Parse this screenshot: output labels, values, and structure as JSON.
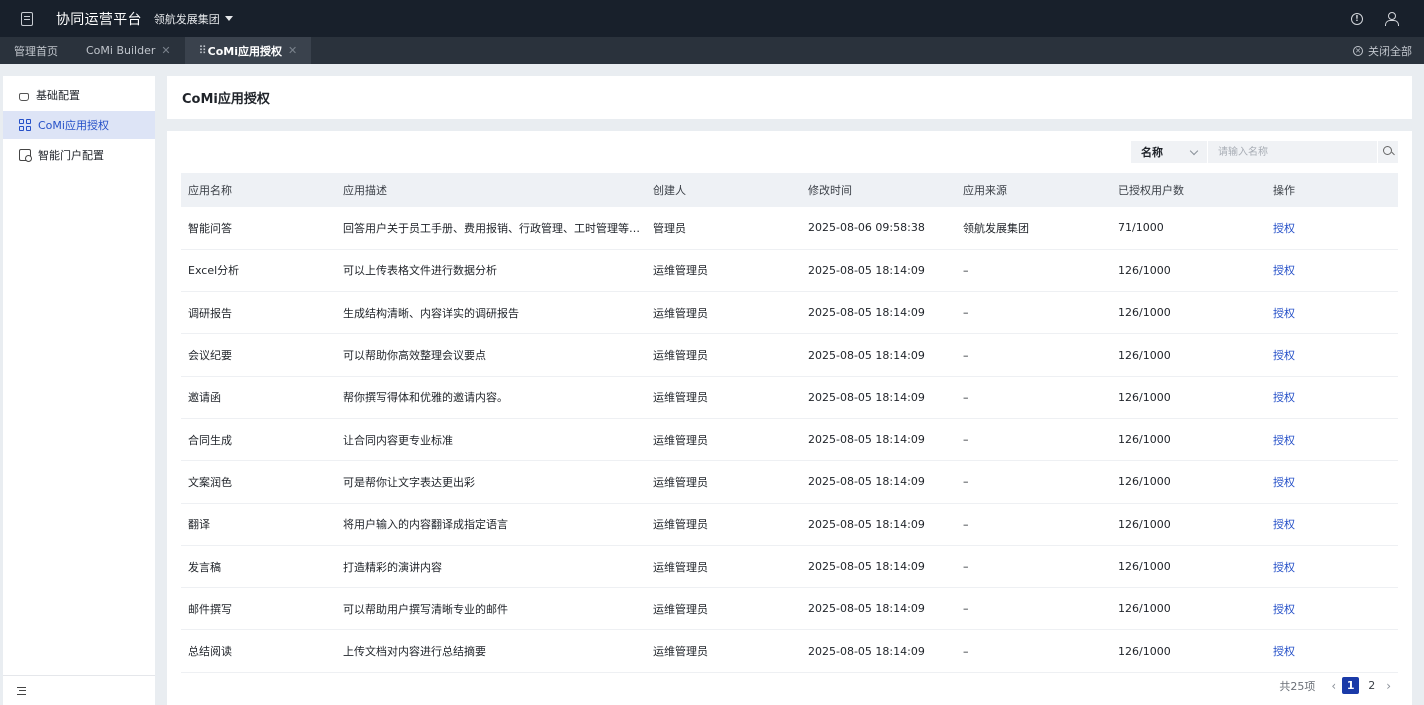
{
  "topbar": {
    "app_title": "协同运营平台",
    "org_name": "领航发展集团"
  },
  "tabs": [
    {
      "label": "管理首页",
      "closable": false
    },
    {
      "label": "CoMi Builder",
      "closable": true
    },
    {
      "label": "CoMi应用授权",
      "closable": true,
      "active": true
    }
  ],
  "tabbar": {
    "close_all": "关闭全部"
  },
  "sidebar": {
    "items": [
      {
        "label": "基础配置",
        "icon": "hand-icon"
      },
      {
        "label": "CoMi应用授权",
        "icon": "grid-icon",
        "active": true
      },
      {
        "label": "智能门户配置",
        "icon": "portal-icon"
      }
    ]
  },
  "page": {
    "title": "CoMi应用授权"
  },
  "search": {
    "field_selected": "名称",
    "placeholder": "请输入名称"
  },
  "table": {
    "columns": [
      "应用名称",
      "应用描述",
      "创建人",
      "修改时间",
      "应用来源",
      "已授权用户数",
      "操作"
    ],
    "rows": [
      {
        "name": "智能问答",
        "desc": "回答用户关于员工手册、费用报销、行政管理、工时管理等相…",
        "creator": "管理员",
        "modified": "2025-08-06 09:58:38",
        "source": "领航发展集团",
        "users": "71/1000",
        "action": "授权"
      },
      {
        "name": "Excel分析",
        "desc": "可以上传表格文件进行数据分析",
        "creator": "运维管理员",
        "modified": "2025-08-05 18:14:09",
        "source": "–",
        "users": "126/1000",
        "action": "授权"
      },
      {
        "name": "调研报告",
        "desc": "生成结构清晰、内容详实的调研报告",
        "creator": "运维管理员",
        "modified": "2025-08-05 18:14:09",
        "source": "–",
        "users": "126/1000",
        "action": "授权"
      },
      {
        "name": "会议纪要",
        "desc": "可以帮助你高效整理会议要点",
        "creator": "运维管理员",
        "modified": "2025-08-05 18:14:09",
        "source": "–",
        "users": "126/1000",
        "action": "授权"
      },
      {
        "name": "邀请函",
        "desc": "帮你撰写得体和优雅的邀请内容。",
        "creator": "运维管理员",
        "modified": "2025-08-05 18:14:09",
        "source": "–",
        "users": "126/1000",
        "action": "授权"
      },
      {
        "name": "合同生成",
        "desc": "让合同内容更专业标准",
        "creator": "运维管理员",
        "modified": "2025-08-05 18:14:09",
        "source": "–",
        "users": "126/1000",
        "action": "授权"
      },
      {
        "name": "文案润色",
        "desc": "可是帮你让文字表达更出彩",
        "creator": "运维管理员",
        "modified": "2025-08-05 18:14:09",
        "source": "–",
        "users": "126/1000",
        "action": "授权"
      },
      {
        "name": "翻译",
        "desc": "将用户输入的内容翻译成指定语言",
        "creator": "运维管理员",
        "modified": "2025-08-05 18:14:09",
        "source": "–",
        "users": "126/1000",
        "action": "授权"
      },
      {
        "name": "发言稿",
        "desc": "打造精彩的演讲内容",
        "creator": "运维管理员",
        "modified": "2025-08-05 18:14:09",
        "source": "–",
        "users": "126/1000",
        "action": "授权"
      },
      {
        "name": "邮件撰写",
        "desc": "可以帮助用户撰写清晰专业的邮件",
        "creator": "运维管理员",
        "modified": "2025-08-05 18:14:09",
        "source": "–",
        "users": "126/1000",
        "action": "授权"
      },
      {
        "name": "总结阅读",
        "desc": "上传文档对内容进行总结摘要",
        "creator": "运维管理员",
        "modified": "2025-08-05 18:14:09",
        "source": "–",
        "users": "126/1000",
        "action": "授权"
      }
    ]
  },
  "pagination": {
    "total": "共25项",
    "pages": [
      "1",
      "2"
    ],
    "current": "1"
  },
  "colors": {
    "topbar_bg": "#18202b",
    "tabbar_bg": "#2a323c",
    "accent": "#2550c8",
    "page_current": "#1a3aa8"
  }
}
